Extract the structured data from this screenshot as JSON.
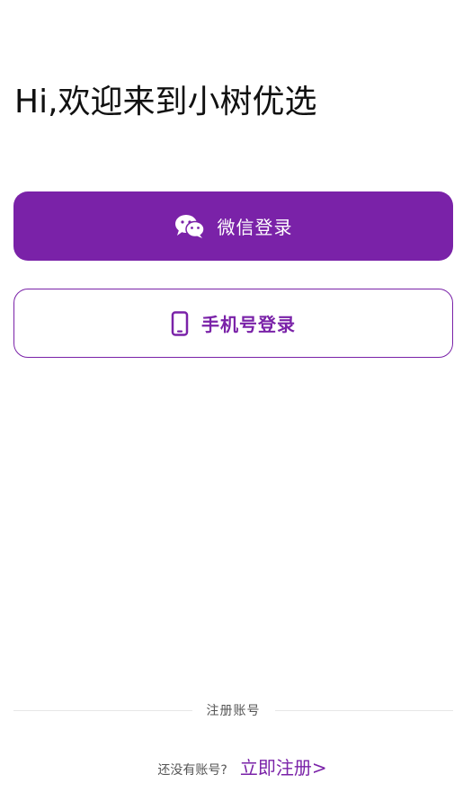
{
  "greeting": "Hi,欢迎来到小树优选",
  "wechat_login": {
    "label": "微信登录",
    "icon": "wechat-icon"
  },
  "phone_login": {
    "label": "手机号登录",
    "icon": "mobile-phone-icon"
  },
  "divider_label": "注册账号",
  "register": {
    "prompt": "还没有账号?",
    "link_label": "立即注册>"
  },
  "colors": {
    "accent": "#7a22a8",
    "background": "#ffffff",
    "text": "#111111",
    "muted_text": "#555555",
    "divider": "#e6e6e6"
  }
}
